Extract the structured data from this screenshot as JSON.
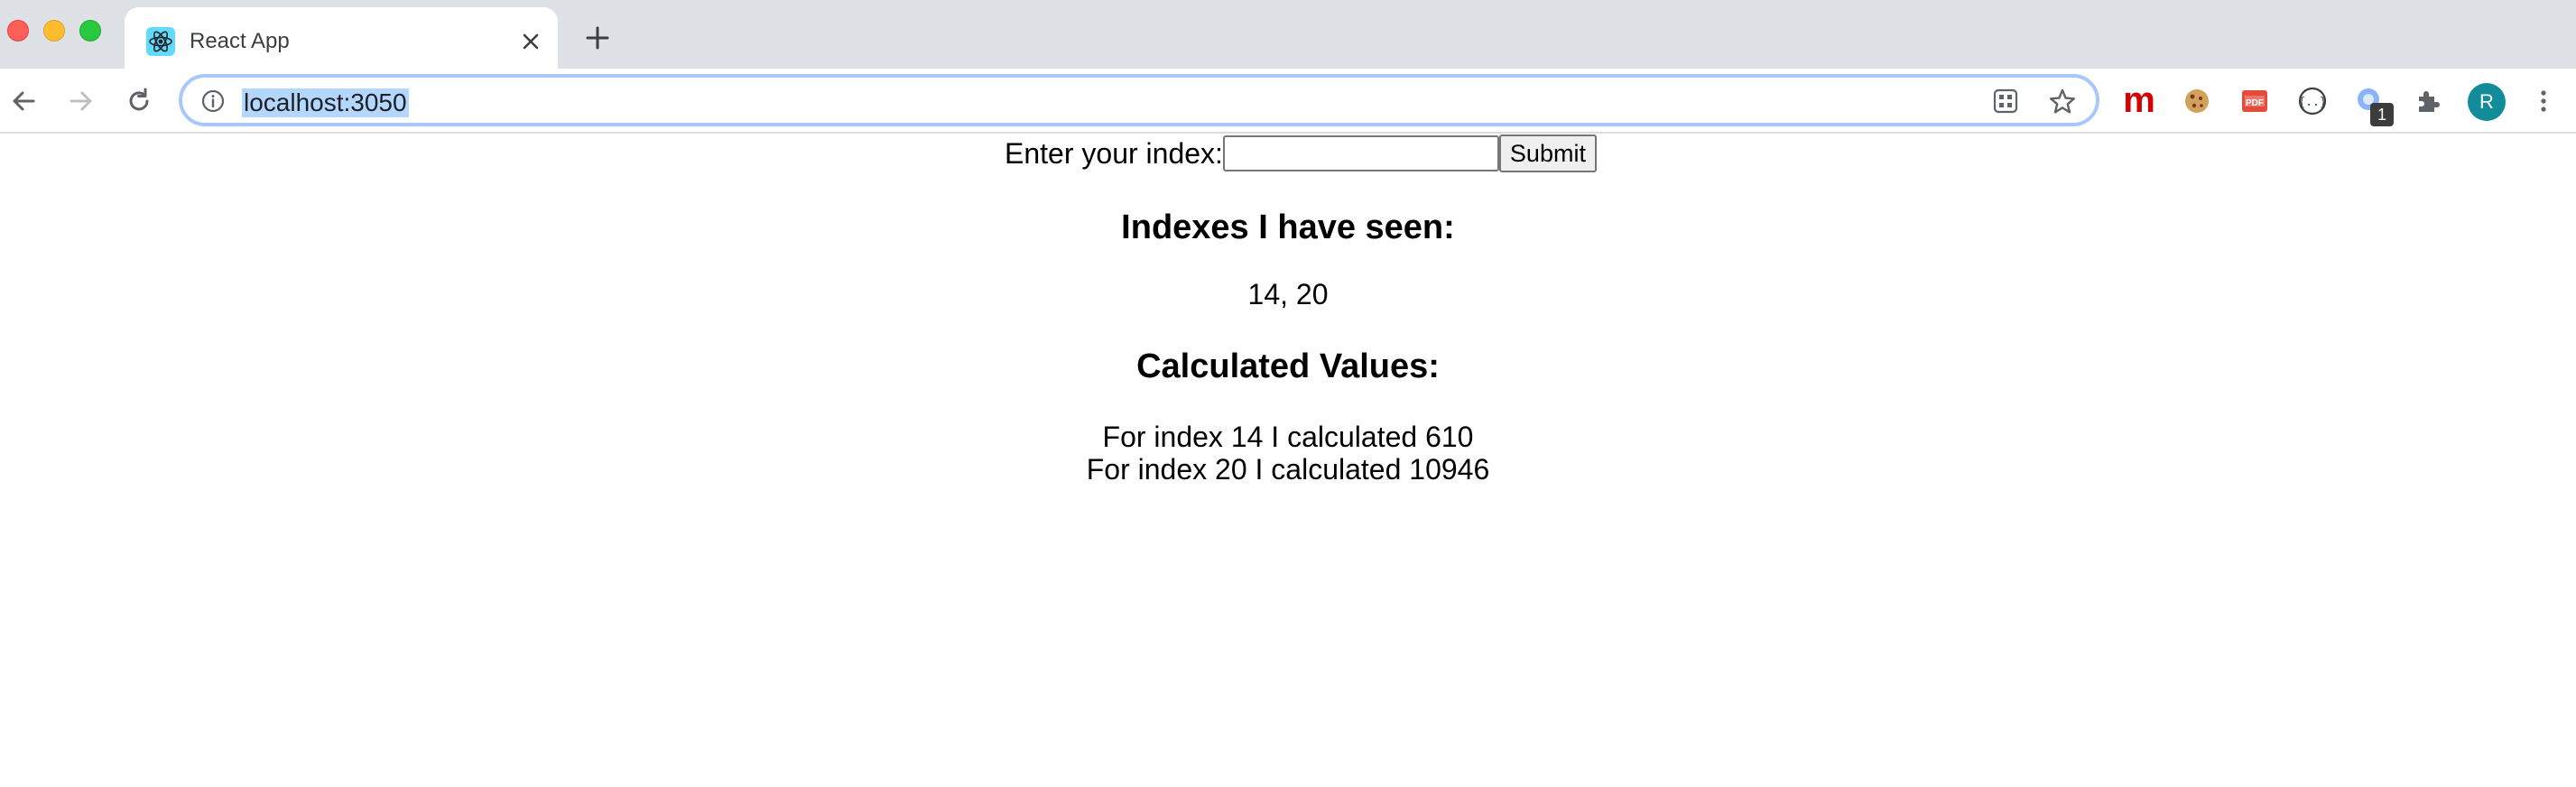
{
  "browser": {
    "tab": {
      "title": "React App",
      "favicon": "react-logo-icon"
    },
    "url": "localhost:3050",
    "extensions": {
      "m_label": "m",
      "badge_count": "1"
    },
    "profile_initial": "R",
    "colors": {
      "tabstrip": "#dee1e6",
      "omnibox_border": "#a8c7fa",
      "url_selection": "#b3d7ff",
      "avatar": "#128c99",
      "m_extension": "#d50000"
    }
  },
  "page": {
    "form": {
      "label": "Enter your index:",
      "input_value": "",
      "submit_label": "Submit"
    },
    "seen_heading": "Indexes I have seen:",
    "seen_indexes": "14, 20",
    "calc_heading": "Calculated Values:",
    "calculated": [
      {
        "text": "For index 14 I calculated 610"
      },
      {
        "text": "For index 20 I calculated 10946"
      }
    ]
  }
}
